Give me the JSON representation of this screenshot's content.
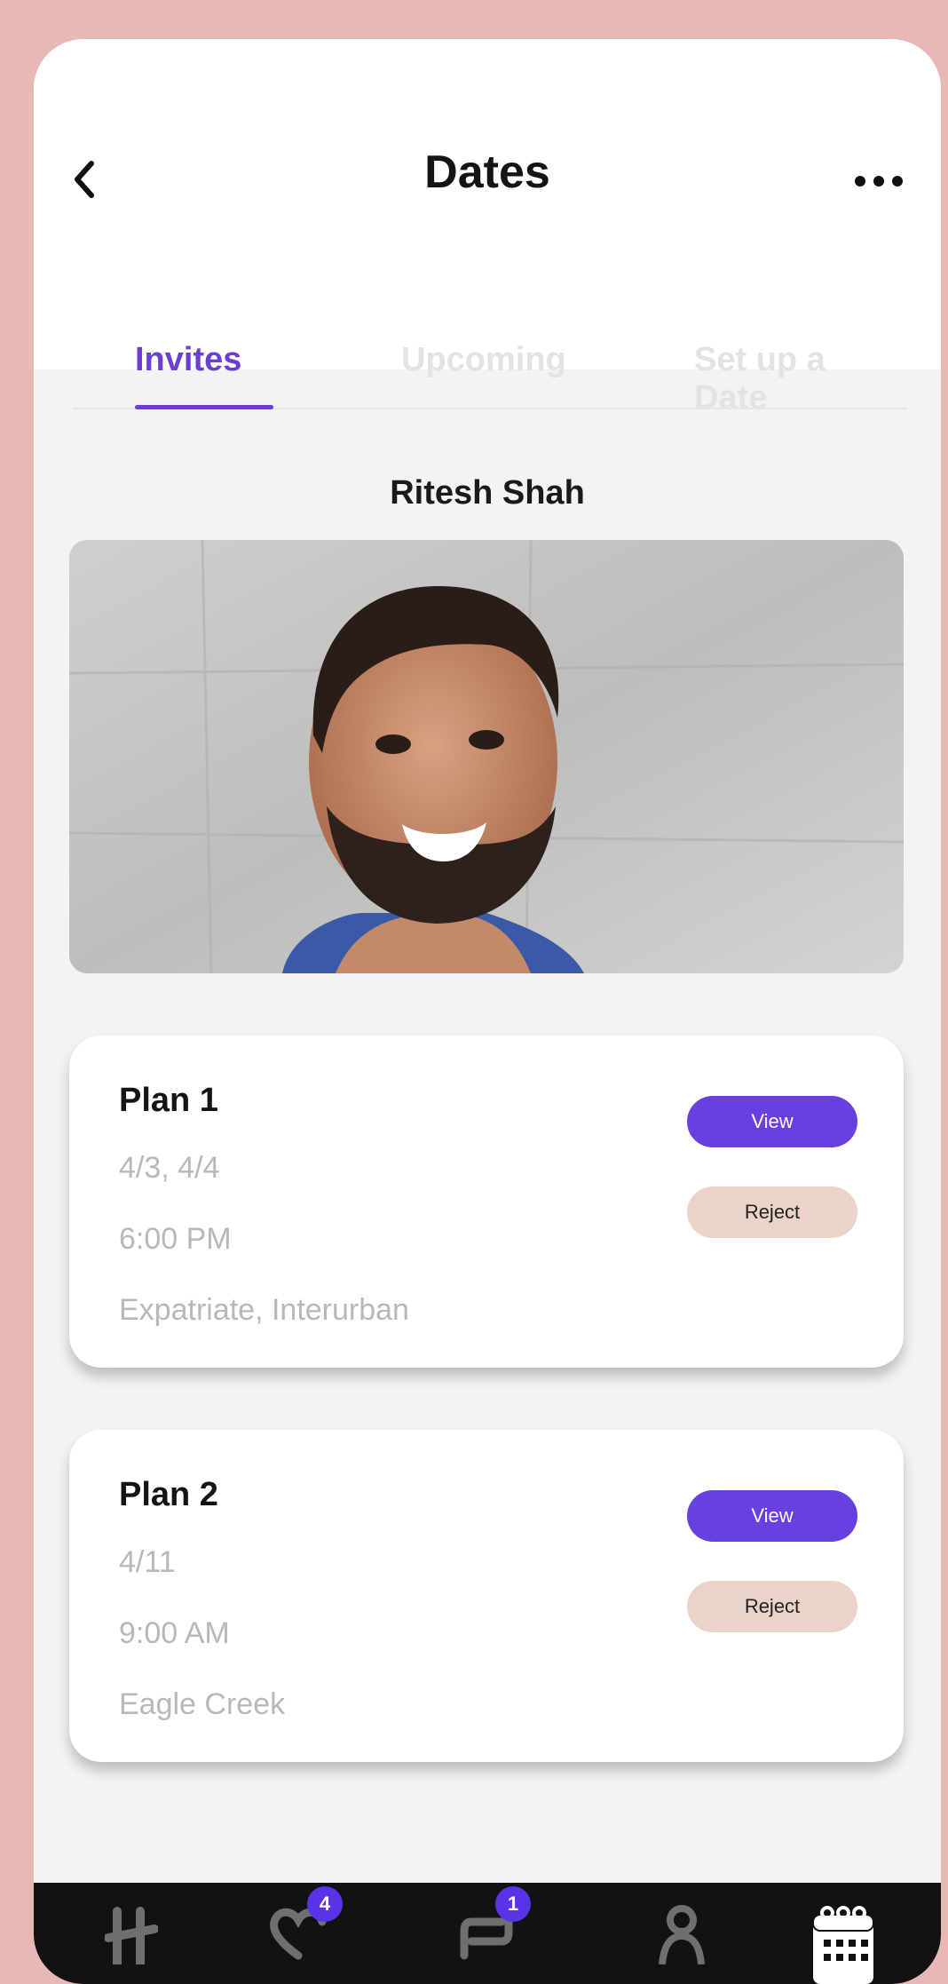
{
  "header": {
    "title": "Dates"
  },
  "tabs": [
    {
      "label": "Invites",
      "active": true
    },
    {
      "label": "Upcoming",
      "active": false
    },
    {
      "label": "Set up a Date",
      "active": false
    }
  ],
  "profile": {
    "name": "Ritesh Shah"
  },
  "plans": [
    {
      "title": "Plan 1",
      "dates": "4/3, 4/4",
      "time": "6:00 PM",
      "places": "Expatriate, Interurban",
      "view_label": "View",
      "reject_label": "Reject"
    },
    {
      "title": "Plan 2",
      "dates": "4/11",
      "time": "9:00 AM",
      "places": "Eagle Creek",
      "view_label": "View",
      "reject_label": "Reject"
    }
  ],
  "bottom_nav": {
    "items": [
      {
        "icon": "home-icon"
      },
      {
        "icon": "likes-icon",
        "badge": "4"
      },
      {
        "icon": "chat-icon",
        "badge": "1"
      },
      {
        "icon": "profile-icon"
      },
      {
        "icon": "calendar-icon",
        "active": true
      }
    ]
  },
  "colors": {
    "accent": "#6b3fd4",
    "reject": "#ecd3ca",
    "background": "#e8b8b7"
  }
}
